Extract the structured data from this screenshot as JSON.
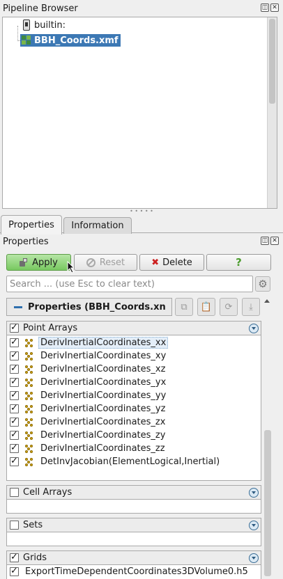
{
  "pipeline_browser": {
    "title": "Pipeline Browser",
    "items": [
      {
        "label": "builtin:"
      },
      {
        "label": "BBH_Coords.xmf"
      }
    ]
  },
  "tabs": [
    {
      "label": "Properties"
    },
    {
      "label": "Information"
    }
  ],
  "properties_panel": {
    "title": "Properties",
    "apply_label": "Apply",
    "reset_label": "Reset",
    "delete_label": "Delete",
    "help_label": "?",
    "search_placeholder": "Search ... (use Esc to clear text)",
    "section_title": "Properties (BBH_Coords.xn"
  },
  "point_arrays": {
    "title": "Point Arrays",
    "checked": true,
    "items": [
      {
        "label": "DerivInertialCoordinates_xx",
        "checked": true
      },
      {
        "label": "DerivInertialCoordinates_xy",
        "checked": true
      },
      {
        "label": "DerivInertialCoordinates_xz",
        "checked": true
      },
      {
        "label": "DerivInertialCoordinates_yx",
        "checked": true
      },
      {
        "label": "DerivInertialCoordinates_yy",
        "checked": true
      },
      {
        "label": "DerivInertialCoordinates_yz",
        "checked": true
      },
      {
        "label": "DerivInertialCoordinates_zx",
        "checked": true
      },
      {
        "label": "DerivInertialCoordinates_zy",
        "checked": true
      },
      {
        "label": "DerivInertialCoordinates_zz",
        "checked": true
      },
      {
        "label": "DetInvJacobian(ElementLogical,Inertial)",
        "checked": true
      }
    ]
  },
  "cell_arrays": {
    "title": "Cell Arrays",
    "checked": false
  },
  "sets": {
    "title": "Sets",
    "checked": false
  },
  "grids": {
    "title": "Grids",
    "checked": true,
    "items": [
      {
        "label": "ExportTimeDependentCoordinates3DVolume0.h5",
        "checked": true
      }
    ]
  },
  "colors": {
    "selection": "#3c78b4",
    "apply": "#78c860",
    "delete_icon": "#cc1f1f",
    "help_icon": "#4c9c2e"
  }
}
